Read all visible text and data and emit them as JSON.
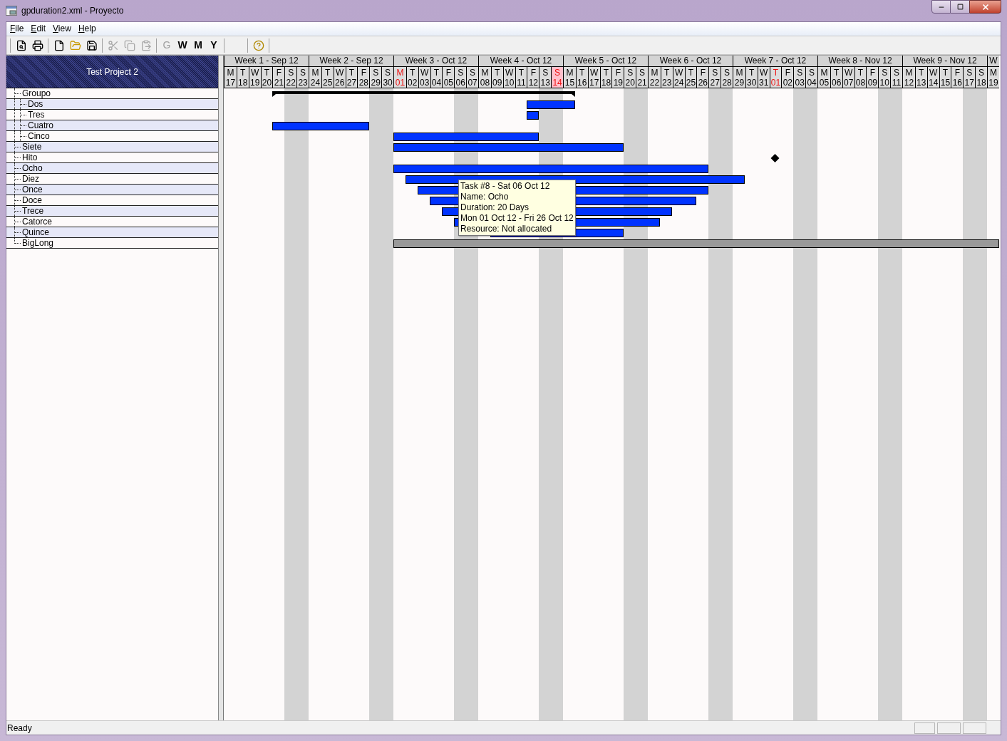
{
  "window": {
    "title": "gpduration2.xml - Proyecto"
  },
  "menu": [
    {
      "label": "File"
    },
    {
      "label": "Edit"
    },
    {
      "label": "View"
    },
    {
      "label": "Help"
    }
  ],
  "toolbar": [
    [
      {
        "kind": "preview",
        "disabled": false
      },
      {
        "kind": "print",
        "disabled": false
      }
    ],
    [
      {
        "kind": "new",
        "disabled": false
      },
      {
        "kind": "open",
        "disabled": false
      },
      {
        "kind": "save",
        "disabled": false
      }
    ],
    [
      {
        "kind": "cut",
        "disabled": true
      },
      {
        "kind": "copy",
        "disabled": true
      },
      {
        "kind": "paste",
        "disabled": true
      }
    ],
    [
      {
        "kind": "text",
        "label": "G",
        "disabled": true
      },
      {
        "kind": "text",
        "label": "W",
        "disabled": false
      },
      {
        "kind": "text",
        "label": "M",
        "disabled": false
      },
      {
        "kind": "text",
        "label": "Y",
        "disabled": false
      }
    ],
    [
      {
        "kind": "help",
        "disabled": false
      }
    ]
  ],
  "project": {
    "title": "Test Project 2"
  },
  "tasks": [
    {
      "name": "Groupo",
      "kind": "summary",
      "children": [
        {
          "name": "Dos",
          "kind": "task"
        },
        {
          "name": "Tres",
          "kind": "task"
        },
        {
          "name": "Cuatro",
          "kind": "task"
        },
        {
          "name": "Cinco",
          "kind": "task"
        }
      ]
    },
    {
      "name": "Siete",
      "kind": "task"
    },
    {
      "name": "Hito",
      "kind": "milestone"
    },
    {
      "name": "Ocho",
      "kind": "task"
    },
    {
      "name": "Diez",
      "kind": "task"
    },
    {
      "name": "Once",
      "kind": "task"
    },
    {
      "name": "Doce",
      "kind": "task"
    },
    {
      "name": "Trece",
      "kind": "task"
    },
    {
      "name": "Catorce",
      "kind": "task"
    },
    {
      "name": "Quince",
      "kind": "task"
    },
    {
      "name": "BigLong",
      "kind": "long"
    }
  ],
  "timeline": {
    "weeks": [
      {
        "label": "Week 1 - Sep 12",
        "days": [
          {
            "weekday": "M",
            "date": "17",
            "kind": "weekday"
          },
          {
            "weekday": "T",
            "date": "18",
            "kind": "weekday"
          },
          {
            "weekday": "W",
            "date": "19",
            "kind": "weekday"
          },
          {
            "weekday": "T",
            "date": "20",
            "kind": "weekday"
          },
          {
            "weekday": "F",
            "date": "21",
            "kind": "weekday"
          },
          {
            "weekday": "S",
            "date": "22",
            "kind": "weekend"
          },
          {
            "weekday": "S",
            "date": "23",
            "kind": "weekend"
          }
        ]
      },
      {
        "label": "Week 2 - Sep 12",
        "days": [
          {
            "weekday": "M",
            "date": "24",
            "kind": "weekday"
          },
          {
            "weekday": "T",
            "date": "25",
            "kind": "weekday"
          },
          {
            "weekday": "W",
            "date": "26",
            "kind": "weekday"
          },
          {
            "weekday": "T",
            "date": "27",
            "kind": "weekday"
          },
          {
            "weekday": "F",
            "date": "28",
            "kind": "weekday"
          },
          {
            "weekday": "S",
            "date": "29",
            "kind": "weekend"
          },
          {
            "weekday": "S",
            "date": "30",
            "kind": "weekend"
          }
        ]
      },
      {
        "label": "Week 3 - Oct 12",
        "days": [
          {
            "weekday": "M",
            "date": "01",
            "kind": "month-start"
          },
          {
            "weekday": "T",
            "date": "02",
            "kind": "weekday"
          },
          {
            "weekday": "W",
            "date": "03",
            "kind": "weekday"
          },
          {
            "weekday": "T",
            "date": "04",
            "kind": "weekday"
          },
          {
            "weekday": "F",
            "date": "05",
            "kind": "weekday"
          },
          {
            "weekday": "S",
            "date": "06",
            "kind": "weekend"
          },
          {
            "weekday": "S",
            "date": "07",
            "kind": "weekend"
          }
        ]
      },
      {
        "label": "Week 4 - Oct 12",
        "days": [
          {
            "weekday": "M",
            "date": "08",
            "kind": "weekday"
          },
          {
            "weekday": "T",
            "date": "09",
            "kind": "weekday"
          },
          {
            "weekday": "W",
            "date": "10",
            "kind": "weekday"
          },
          {
            "weekday": "T",
            "date": "11",
            "kind": "weekday"
          },
          {
            "weekday": "F",
            "date": "12",
            "kind": "weekday"
          },
          {
            "weekday": "S",
            "date": "13",
            "kind": "weekend"
          },
          {
            "weekday": "S",
            "date": "14",
            "kind": "marked-weekend"
          }
        ]
      },
      {
        "label": "Week 5 - Oct 12",
        "days": [
          {
            "weekday": "M",
            "date": "15",
            "kind": "weekday"
          },
          {
            "weekday": "T",
            "date": "16",
            "kind": "weekday"
          },
          {
            "weekday": "W",
            "date": "17",
            "kind": "weekday"
          },
          {
            "weekday": "T",
            "date": "18",
            "kind": "weekday"
          },
          {
            "weekday": "F",
            "date": "19",
            "kind": "weekday"
          },
          {
            "weekday": "S",
            "date": "20",
            "kind": "weekend"
          },
          {
            "weekday": "S",
            "date": "21",
            "kind": "weekend"
          }
        ]
      },
      {
        "label": "Week 6 - Oct 12",
        "days": [
          {
            "weekday": "M",
            "date": "22",
            "kind": "weekday"
          },
          {
            "weekday": "T",
            "date": "23",
            "kind": "weekday"
          },
          {
            "weekday": "W",
            "date": "24",
            "kind": "weekday"
          },
          {
            "weekday": "T",
            "date": "25",
            "kind": "weekday"
          },
          {
            "weekday": "F",
            "date": "26",
            "kind": "weekday"
          },
          {
            "weekday": "S",
            "date": "27",
            "kind": "weekend"
          },
          {
            "weekday": "S",
            "date": "28",
            "kind": "weekend"
          }
        ]
      },
      {
        "label": "Week 7 - Oct 12",
        "days": [
          {
            "weekday": "M",
            "date": "29",
            "kind": "weekday"
          },
          {
            "weekday": "T",
            "date": "30",
            "kind": "weekday"
          },
          {
            "weekday": "W",
            "date": "31",
            "kind": "weekday"
          },
          {
            "weekday": "T",
            "date": "01",
            "kind": "month-start"
          },
          {
            "weekday": "F",
            "date": "02",
            "kind": "weekday"
          },
          {
            "weekday": "S",
            "date": "03",
            "kind": "weekend"
          },
          {
            "weekday": "S",
            "date": "04",
            "kind": "weekend"
          }
        ]
      },
      {
        "label": "Week 8 - Nov 12",
        "days": [
          {
            "weekday": "M",
            "date": "05",
            "kind": "weekday"
          },
          {
            "weekday": "T",
            "date": "06",
            "kind": "weekday"
          },
          {
            "weekday": "W",
            "date": "07",
            "kind": "weekday"
          },
          {
            "weekday": "T",
            "date": "08",
            "kind": "weekday"
          },
          {
            "weekday": "F",
            "date": "09",
            "kind": "weekday"
          },
          {
            "weekday": "S",
            "date": "10",
            "kind": "weekend"
          },
          {
            "weekday": "S",
            "date": "11",
            "kind": "weekend"
          }
        ]
      },
      {
        "label": "Week 9 - Nov 12",
        "days": [
          {
            "weekday": "M",
            "date": "12",
            "kind": "weekday"
          },
          {
            "weekday": "T",
            "date": "13",
            "kind": "weekday"
          },
          {
            "weekday": "W",
            "date": "14",
            "kind": "weekday"
          },
          {
            "weekday": "T",
            "date": "15",
            "kind": "weekday"
          },
          {
            "weekday": "F",
            "date": "16",
            "kind": "weekday"
          },
          {
            "weekday": "S",
            "date": "17",
            "kind": "weekend"
          },
          {
            "weekday": "S",
            "date": "18",
            "kind": "weekend"
          }
        ]
      },
      {
        "label": "W",
        "days": [
          {
            "weekday": "M",
            "date": "19",
            "kind": "weekday"
          }
        ]
      }
    ]
  },
  "tooltip": {
    "lines": [
      "Task #8 - Sat 06 Oct 12",
      "Name: Ocho",
      "Duration: 20 Days",
      "Mon 01 Oct 12 - Fri 26 Oct 12",
      "Resource: Not allocated"
    ]
  },
  "status_bar": {
    "text": "Ready"
  }
}
